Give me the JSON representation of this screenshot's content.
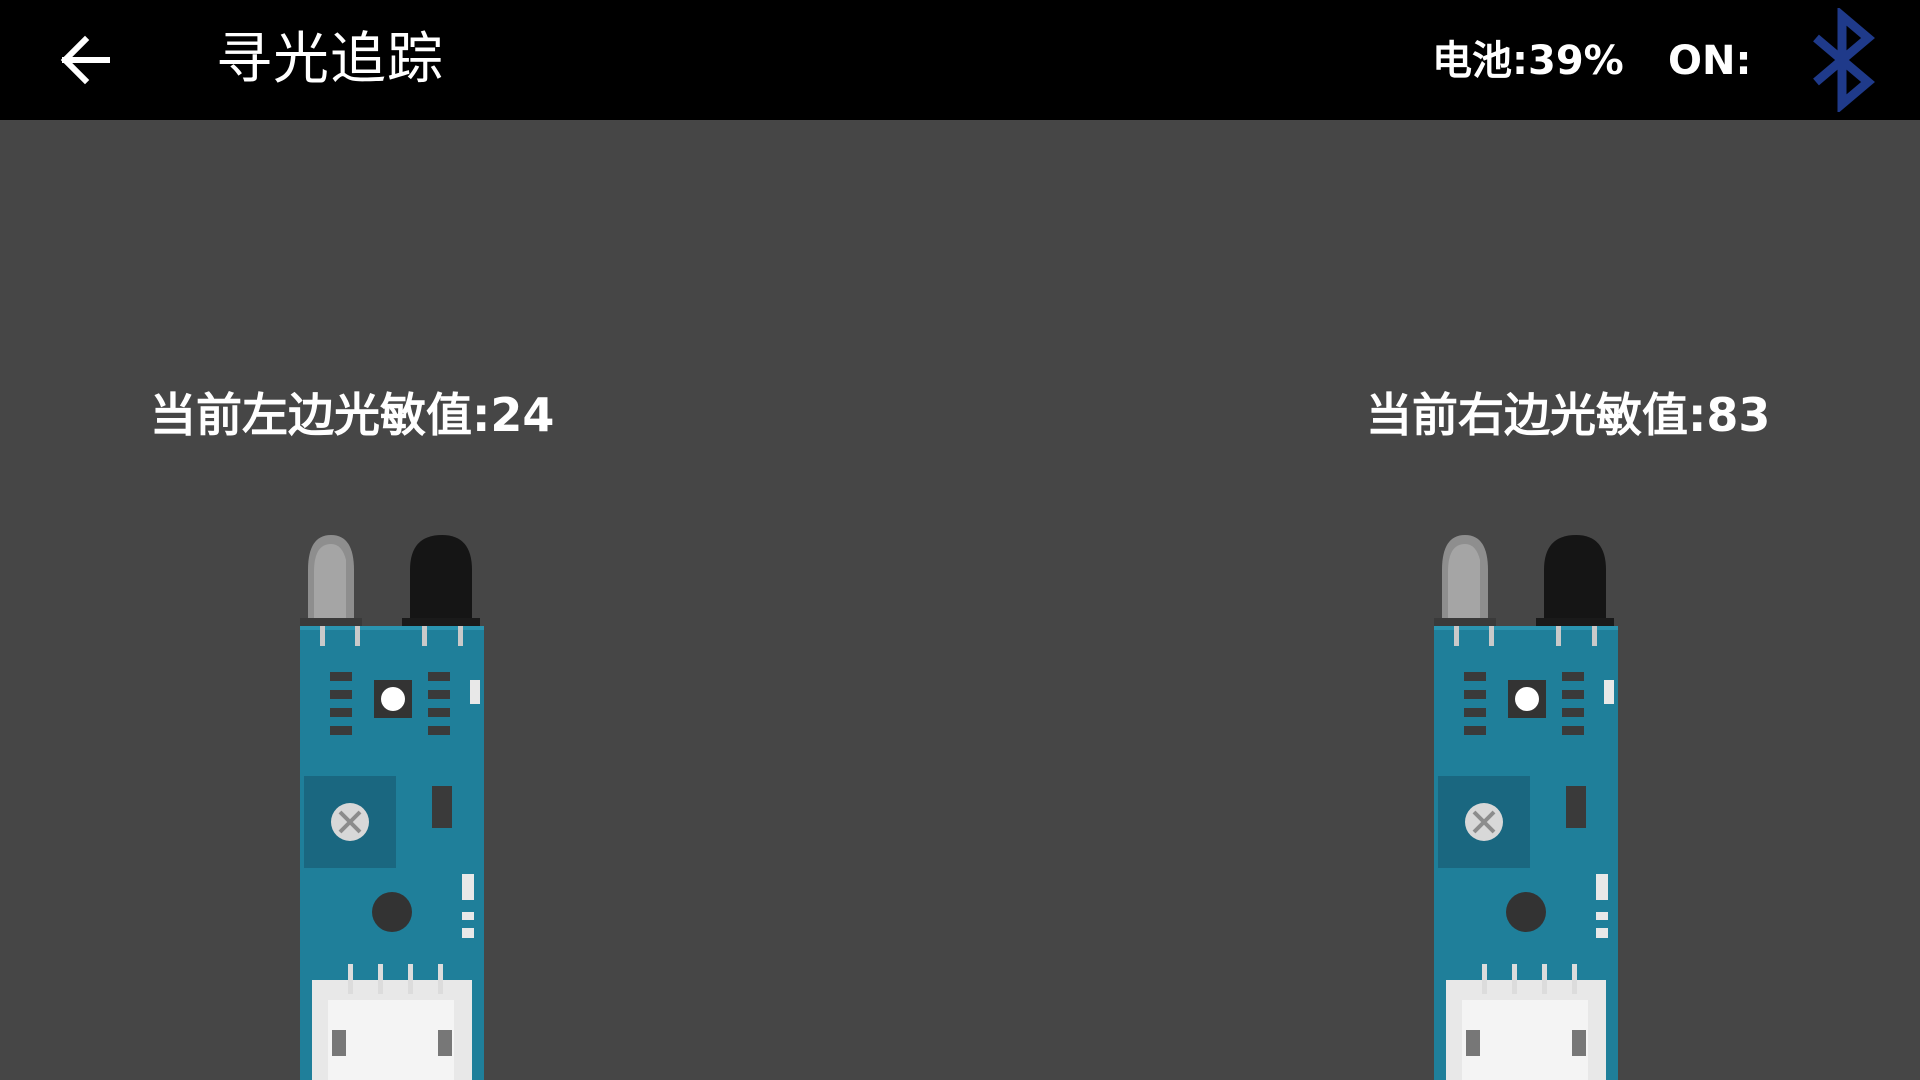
{
  "header": {
    "back_icon": "arrow-left-icon",
    "title": "寻光追踪",
    "battery_text": "电池:39%",
    "status_text": "ON:",
    "bluetooth_icon": "bluetooth-icon",
    "bluetooth_color": "#1f3a8a"
  },
  "sensors": {
    "left_label": "当前左边光敏值:24",
    "right_label": "当前右边光敏值:83"
  },
  "colors": {
    "background": "#464646",
    "topbar": "#000000",
    "pcb": "#1f7f9a"
  }
}
